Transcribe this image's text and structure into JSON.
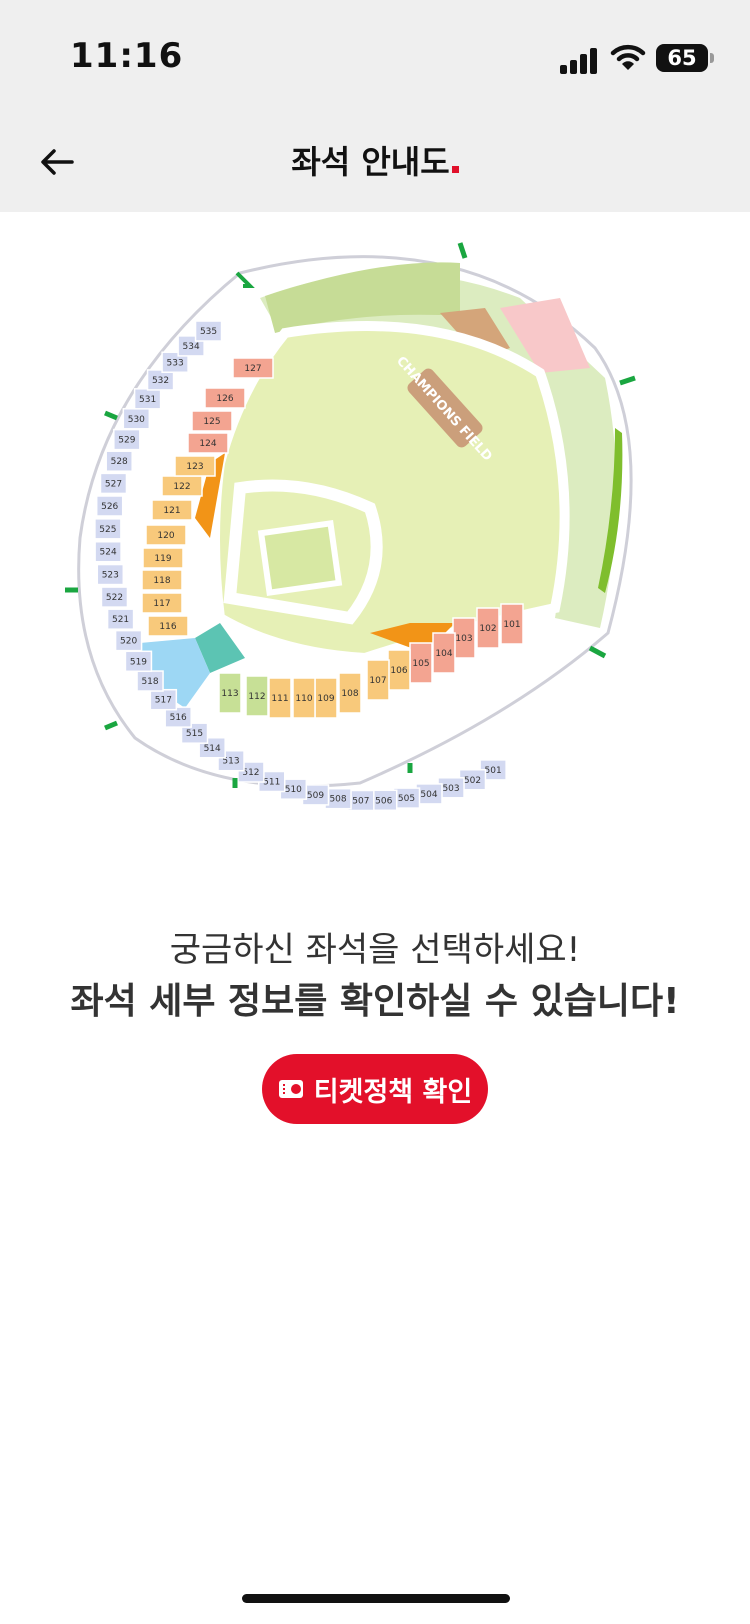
{
  "status": {
    "time": "11:16",
    "battery": "65"
  },
  "header": {
    "title": "좌석 안내도"
  },
  "field": {
    "logo_text": "CHAMPIONS FIELD"
  },
  "seats": {
    "s100": [
      "101",
      "102",
      "103",
      "104",
      "105",
      "106",
      "107",
      "108",
      "109",
      "110",
      "111",
      "112",
      "113",
      "116",
      "117",
      "118",
      "119",
      "120",
      "121",
      "122",
      "123",
      "124",
      "125",
      "126",
      "127"
    ],
    "s500": [
      "501",
      "502",
      "503",
      "504",
      "505",
      "506",
      "507",
      "508",
      "509",
      "510",
      "511",
      "512",
      "513",
      "514",
      "515",
      "516",
      "517",
      "518",
      "519",
      "520",
      "521",
      "522",
      "523",
      "524",
      "525",
      "526",
      "527",
      "528",
      "529",
      "530",
      "531",
      "532",
      "533",
      "534",
      "535"
    ]
  },
  "message": {
    "line1": "궁금하신 좌석을 선택하세요!",
    "line2": "좌석 세부 정보를 확인하실 수 있습니다!"
  },
  "ticket_button": {
    "label": "티켓정책 확인"
  },
  "colors": {
    "accent": "#e3102a",
    "grass": "#e4efb4",
    "seat_orange": "#f8c97b",
    "seat_red": "#f3a491",
    "seat_blue": "#d3d9f1"
  }
}
